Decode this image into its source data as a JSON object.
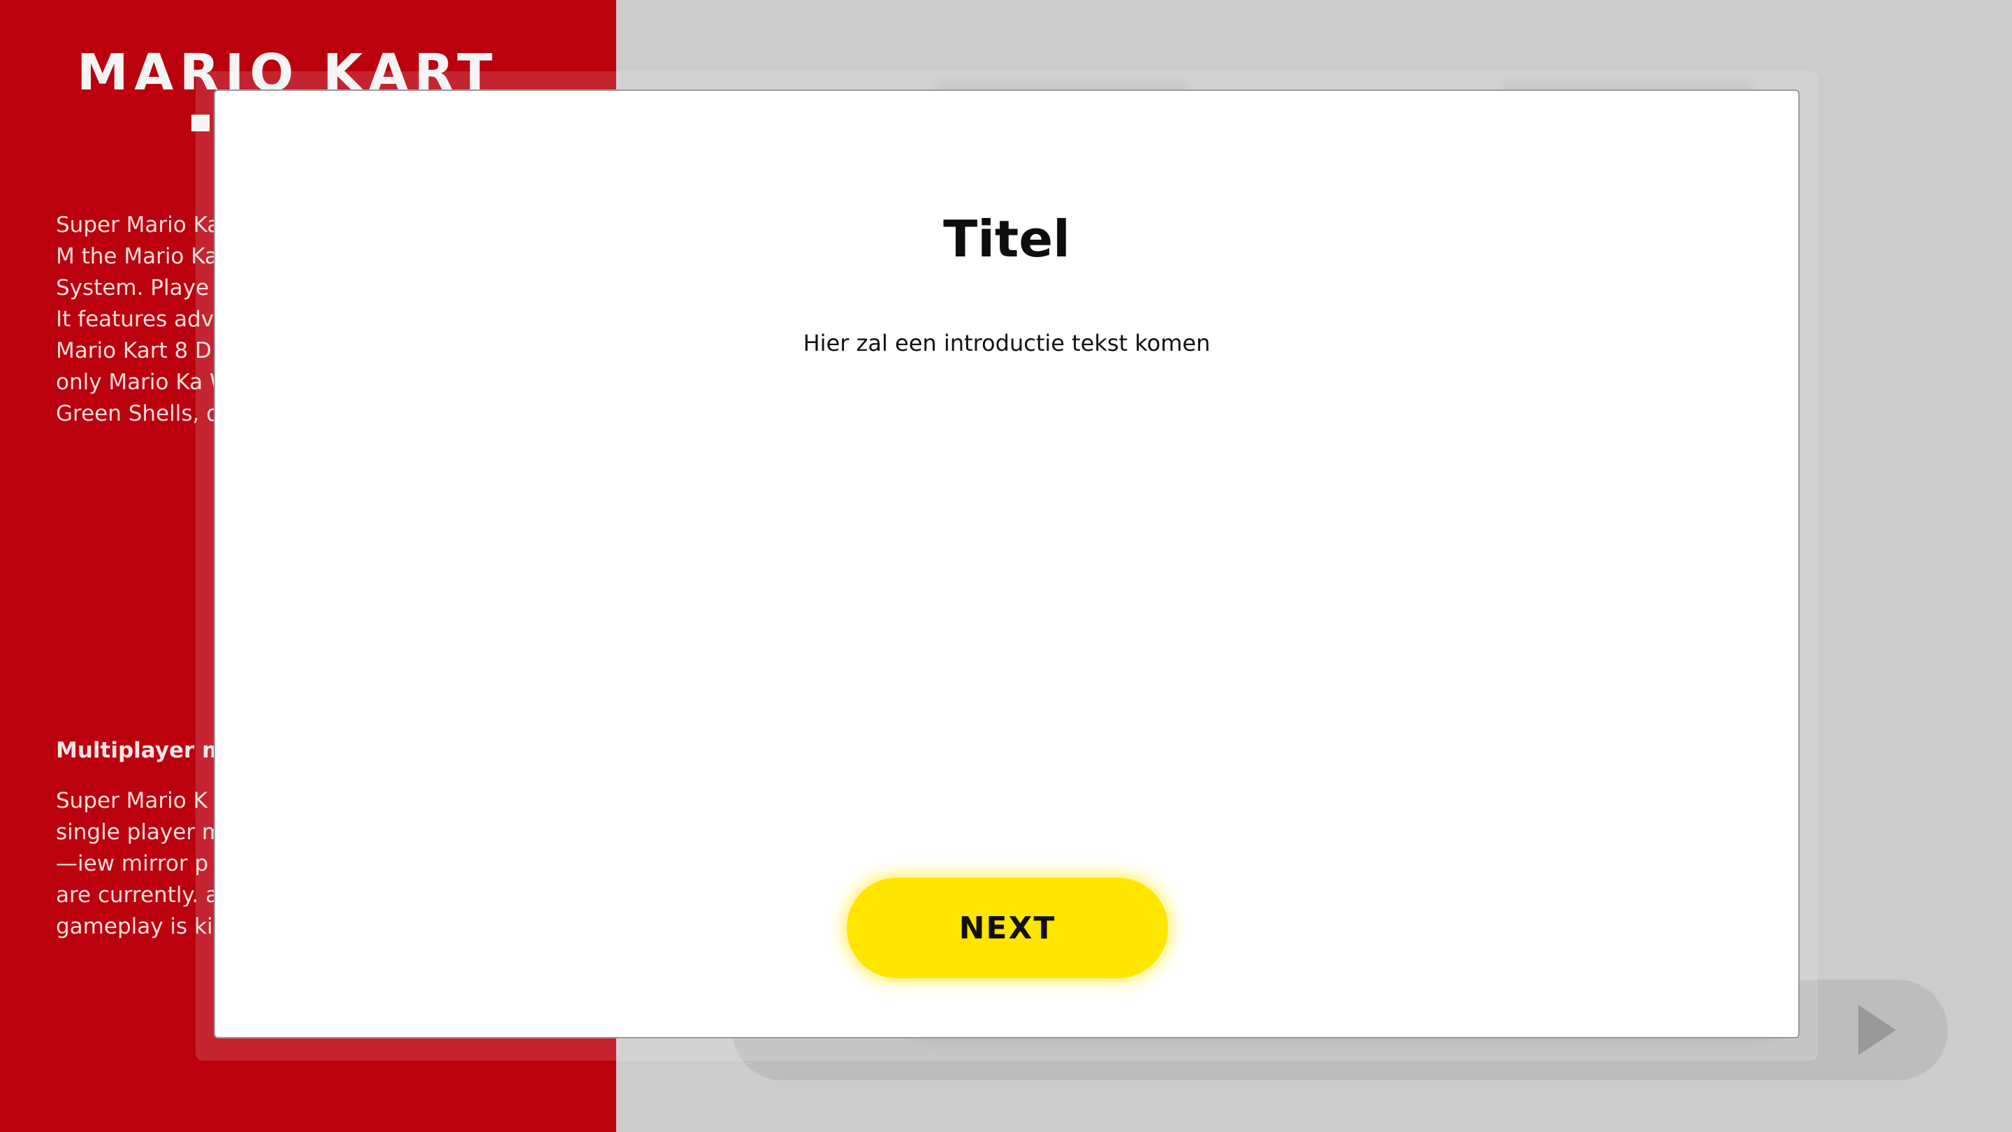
{
  "background": {
    "logo_text": "MARIO KART",
    "article_paragraph_1": "Super Mario Kart カートSūpā M the Mario Kar 27, 1992 for t System. Playe of eight chara It features adv to its use of M Mario Kart 8 D games where only Mario Ka Wario, Spiny S Green Shells, do not appea",
    "article_heading": "Multiplayer m",
    "article_paragraph_2": "Super Mario K players. All ga single player m while the bott —iew mirror p the whole trac are currently. assigned to th gameplay is kind of slippery.",
    "colors": {
      "brand_red": "#bb000e",
      "page_gray": "#cccccc"
    },
    "player": {
      "play_icon": "play-icon"
    }
  },
  "modal": {
    "title": "Titel",
    "intro": "Hier zal een introductie tekst komen",
    "next_label": "NEXT",
    "colors": {
      "button": "#ffe600",
      "surface": "#ffffff"
    }
  }
}
